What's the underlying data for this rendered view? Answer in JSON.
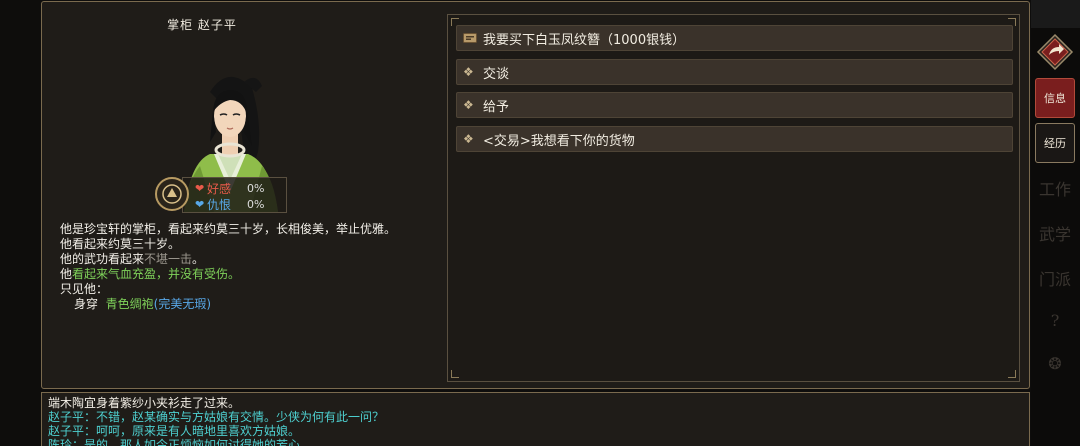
{
  "npc": {
    "title": "掌柜  赵子平",
    "relation": {
      "favor_label": "好感",
      "favor_value": "0%",
      "hatred_label": "仇恨",
      "hatred_value": "0%"
    },
    "description": {
      "line1": "他是珍宝轩的掌柜，看起来约莫三十岁，长相俊美，举止优雅。",
      "line2": "他看起来约莫三十岁。",
      "line3_prefix": "他的武功看起来",
      "line3_grey": "不堪一击",
      "line3_suffix": "。",
      "line4_prefix": "他",
      "line4_green": "看起来气血充盈，并没有受伤。",
      "line5": "只见他：",
      "wear_label": "身穿",
      "wear_item": "青色绸袍",
      "wear_quality_open": "(",
      "wear_quality": "完美无瑕",
      "wear_quality_close": ")"
    }
  },
  "dialogue_options": [
    {
      "label": "我要买下白玉凤纹簪（1000银钱）",
      "icon": "buy-ticket-icon"
    },
    {
      "label": "交谈",
      "icon": "diamond-icon"
    },
    {
      "label": "给予",
      "icon": "diamond-icon"
    },
    {
      "label": "<交易>我想看下你的货物",
      "icon": "diamond-icon"
    }
  ],
  "sidebar": {
    "info_label": "信息",
    "experience_label": "经历",
    "ghost1": "工作",
    "ghost2": "武学",
    "ghost3": "门派",
    "ghost4": "?",
    "ghost5": "❂"
  },
  "log": [
    "端木陶宜身着紫纱小夹衫走了过来。",
    "赵子平：不错，赵某确实与方姑娘有交情。少侠为何有此一问？",
    "赵子平：呵呵，原来是有人暗地里喜欢方姑娘。",
    "陈玲：是的，那人如今正烦恼如何讨得她的芳心。"
  ],
  "colors": {
    "accent_gold": "#b79a62",
    "info_button": "#7a1e1e",
    "favor": "#e85a4a",
    "hatred": "#58a8e8",
    "health_green": "#7fd25a",
    "log_dialogue": "#4ed0d0"
  }
}
